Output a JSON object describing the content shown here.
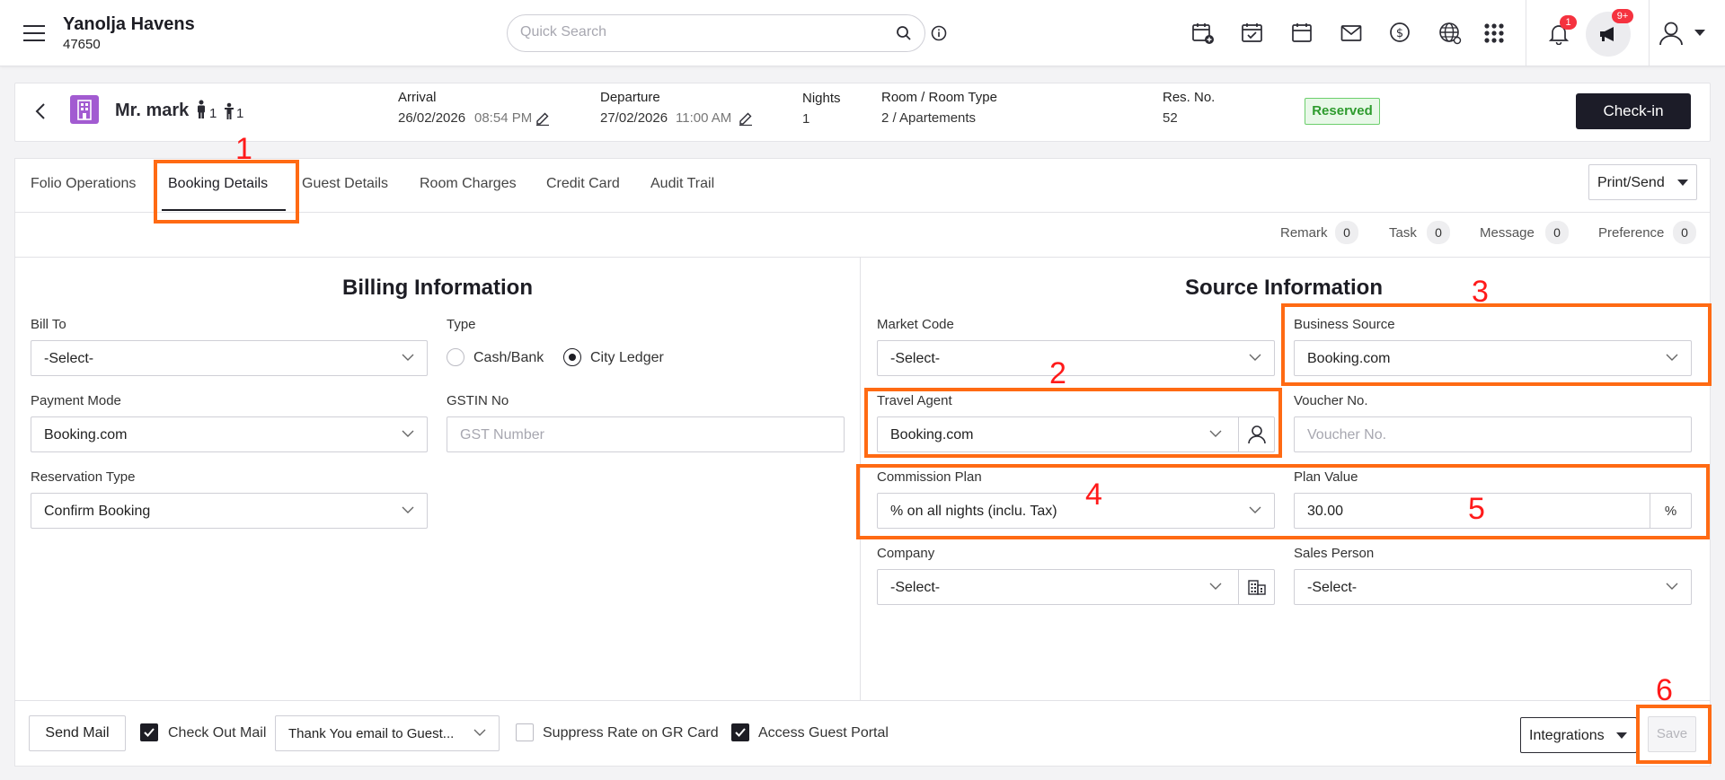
{
  "header": {
    "hotel_name": "Yanolja Havens",
    "hotel_id": "47650",
    "search_placeholder": "Quick Search",
    "notification_count": "1",
    "announcement_count": "9+"
  },
  "reservation": {
    "guest_name": "Mr. mark",
    "adults": "1",
    "children": "1",
    "arrival_label": "Arrival",
    "arrival_date": "26/02/2026",
    "arrival_time": "08:54 PM",
    "departure_label": "Departure",
    "departure_date": "27/02/2026",
    "departure_time": "11:00 AM",
    "nights_label": "Nights",
    "nights": "1",
    "room_label": "Room / Room Type",
    "room": "2 / Apartements",
    "resno_label": "Res. No.",
    "resno": "52",
    "status": "Reserved",
    "checkin_label": "Check-in"
  },
  "tabs": [
    "Folio Operations",
    "Booking Details",
    "Guest Details",
    "Room Charges",
    "Credit Card",
    "Audit Trail"
  ],
  "print_send_label": "Print/Send",
  "counters": [
    {
      "label": "Remark",
      "count": "0"
    },
    {
      "label": "Task",
      "count": "0"
    },
    {
      "label": "Message",
      "count": "0"
    },
    {
      "label": "Preference",
      "count": "0"
    }
  ],
  "billing": {
    "title": "Billing Information",
    "bill_to_label": "Bill To",
    "bill_to_value": "-Select-",
    "type_label": "Type",
    "type_options": [
      "Cash/Bank",
      "City Ledger"
    ],
    "type_selected": "City Ledger",
    "payment_mode_label": "Payment Mode",
    "payment_mode_value": "Booking.com",
    "gstin_label": "GSTIN No",
    "gstin_placeholder": "GST Number",
    "reservation_type_label": "Reservation Type",
    "reservation_type_value": "Confirm Booking"
  },
  "source": {
    "title": "Source Information",
    "market_code_label": "Market Code",
    "market_code_value": "-Select-",
    "business_source_label": "Business Source",
    "business_source_value": "Booking.com",
    "travel_agent_label": "Travel Agent",
    "travel_agent_value": "Booking.com",
    "voucher_label": "Voucher No.",
    "voucher_placeholder": "Voucher No.",
    "commission_plan_label": "Commission Plan",
    "commission_plan_value": "% on all nights (inclu. Tax)",
    "plan_value_label": "Plan Value",
    "plan_value": "30.00",
    "plan_unit": "%",
    "company_label": "Company",
    "company_value": "-Select-",
    "sales_person_label": "Sales Person",
    "sales_person_value": "-Select-"
  },
  "footer": {
    "send_mail_label": "Send Mail",
    "checkout_mail_label": "Check Out Mail",
    "checkout_mail_checked": true,
    "email_template_value": "Thank You email to Guest...",
    "suppress_rate_label": "Suppress Rate on GR Card",
    "suppress_rate_checked": false,
    "guest_portal_label": "Access Guest Portal",
    "guest_portal_checked": true,
    "integrations_label": "Integrations",
    "save_label": "Save"
  },
  "annotations": [
    "1",
    "2",
    "3",
    "4",
    "5",
    "6"
  ],
  "colors": {
    "highlight": "#ff6a13",
    "annotation_number": "#ff1a1a",
    "primary_dark": "#1c1c28",
    "status_green": "#2e9b2e"
  }
}
